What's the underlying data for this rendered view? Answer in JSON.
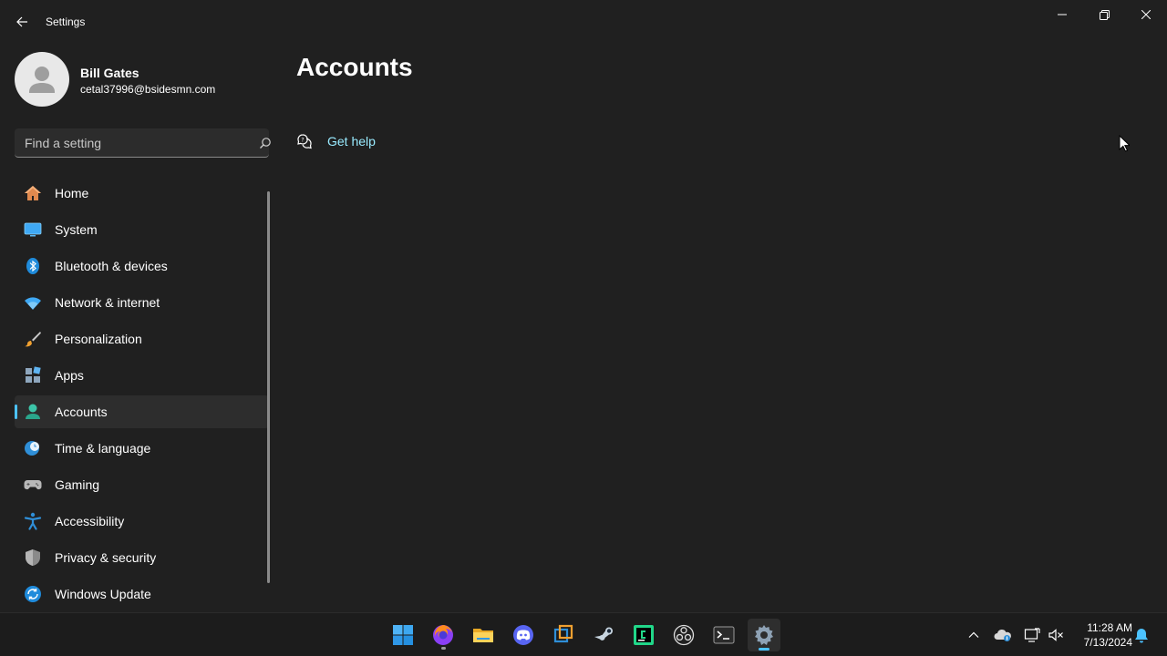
{
  "window": {
    "title": "Settings"
  },
  "profile": {
    "name": "Bill Gates",
    "email": "cetal37996@bsidesmn.com"
  },
  "search": {
    "placeholder": "Find a setting"
  },
  "nav": {
    "items": [
      {
        "label": "Home",
        "icon": "home-icon"
      },
      {
        "label": "System",
        "icon": "system-icon"
      },
      {
        "label": "Bluetooth & devices",
        "icon": "bluetooth-icon"
      },
      {
        "label": "Network & internet",
        "icon": "wifi-icon"
      },
      {
        "label": "Personalization",
        "icon": "brush-icon"
      },
      {
        "label": "Apps",
        "icon": "apps-icon"
      },
      {
        "label": "Accounts",
        "icon": "accounts-icon",
        "active": true
      },
      {
        "label": "Time & language",
        "icon": "globe-clock-icon"
      },
      {
        "label": "Gaming",
        "icon": "gamepad-icon"
      },
      {
        "label": "Accessibility",
        "icon": "accessibility-icon"
      },
      {
        "label": "Privacy & security",
        "icon": "shield-icon"
      },
      {
        "label": "Windows Update",
        "icon": "update-icon"
      }
    ]
  },
  "main": {
    "title": "Accounts",
    "get_help": "Get help"
  },
  "taskbar": {
    "apps": [
      "start",
      "firefox",
      "file-explorer",
      "discord",
      "virtualbox",
      "steam",
      "pycharm",
      "obs",
      "terminal",
      "settings"
    ],
    "active_app": "settings",
    "time": "11:28 AM",
    "date": "7/13/2024"
  },
  "colors": {
    "background": "#202020",
    "accent": "#4cc2ff",
    "link": "#99ebff",
    "taskbar": "#1c1c1c"
  }
}
